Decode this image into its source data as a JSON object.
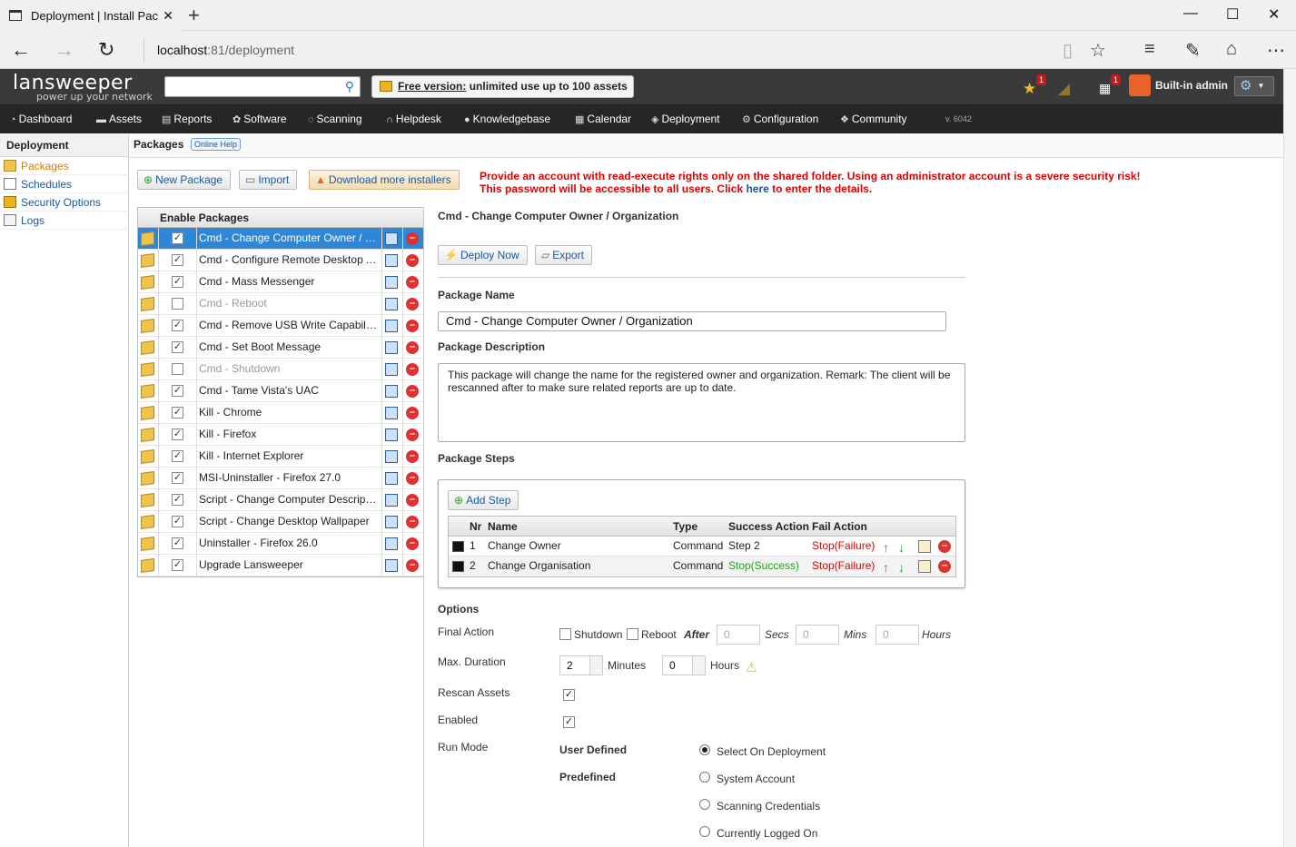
{
  "browser": {
    "tab_title": "Deployment | Install Pac",
    "url_host": "localhost",
    "url_rest": ":81/deployment"
  },
  "header": {
    "logo": "lansweeper",
    "tagline": "power up your network",
    "search_placeholder": "",
    "free_label": "Free version:",
    "free_text": " unlimited use up to 100 assets",
    "badge_star": "1",
    "badge_calendar": "1",
    "user": "Built-in admin"
  },
  "menu": {
    "items": [
      "Dashboard",
      "Assets",
      "Reports",
      "Software",
      "Scanning",
      "Helpdesk",
      "Knowledgebase",
      "Calendar",
      "Deployment",
      "Configuration",
      "Community"
    ],
    "version": "v. 6042"
  },
  "sidebar": {
    "title": "Deployment",
    "items": [
      "Packages",
      "Schedules",
      "Security Options",
      "Logs"
    ]
  },
  "crumb": {
    "title": "Packages",
    "help": "Online Help"
  },
  "toolbar": {
    "new_package": "New Package",
    "import": "Import",
    "download": "Download more installers"
  },
  "warning": {
    "line1": "Provide an account with read-execute rights only on the shared folder. Using an administrator account is a severe security risk!",
    "line2_pre": "This password will be accessible to all users. Click ",
    "line2_link": "here",
    "line2_post": " to enter the details."
  },
  "packages": {
    "header": "Enable Packages",
    "rows": [
      {
        "name": "Cmd - Change Computer Owner / Organization",
        "enabled": true
      },
      {
        "name": "Cmd - Configure Remote Desktop Access",
        "enabled": true
      },
      {
        "name": "Cmd - Mass Messenger",
        "enabled": true
      },
      {
        "name": "Cmd - Reboot",
        "enabled": false
      },
      {
        "name": "Cmd - Remove USB Write Capabilities",
        "enabled": true
      },
      {
        "name": "Cmd - Set Boot Message",
        "enabled": true
      },
      {
        "name": "Cmd - Shutdown",
        "enabled": false
      },
      {
        "name": "Cmd - Tame Vista's UAC",
        "enabled": true
      },
      {
        "name": "Kill - Chrome",
        "enabled": true
      },
      {
        "name": "Kill - Firefox",
        "enabled": true
      },
      {
        "name": "Kill - Internet Explorer",
        "enabled": true
      },
      {
        "name": "MSI-Uninstaller - Firefox 27.0",
        "enabled": true
      },
      {
        "name": "Script - Change Computer Description",
        "enabled": true
      },
      {
        "name": "Script - Change Desktop Wallpaper",
        "enabled": true
      },
      {
        "name": "Uninstaller - Firefox 26.0",
        "enabled": true
      },
      {
        "name": "Upgrade Lansweeper",
        "enabled": true
      }
    ]
  },
  "detail": {
    "title": "Cmd - Change Computer Owner / Organization",
    "deploy_now": "Deploy Now",
    "export": "Export",
    "package_name_label": "Package Name",
    "package_name": "Cmd - Change Computer Owner / Organization",
    "package_desc_label": "Package Description",
    "package_desc": "This package will change the name for the registered owner and organization. Remark: The client will be rescanned after to make sure related reports are up to date.",
    "package_steps_label": "Package Steps",
    "add_step": "Add Step",
    "steps_columns": [
      "Nr",
      "Name",
      "Type",
      "Success Action",
      "Fail Action"
    ],
    "steps": [
      {
        "nr": "1",
        "name": "Change Owner",
        "type": "Command",
        "success": "Step 2",
        "fail": "Stop(Failure)"
      },
      {
        "nr": "2",
        "name": "Change Organisation",
        "type": "Command",
        "success": "Stop(Success)",
        "fail": "Stop(Failure)"
      }
    ],
    "options_label": "Options",
    "final_action_label": "Final Action",
    "shutdown": "Shutdown",
    "reboot": "Reboot",
    "after": "After",
    "secs_value": "0",
    "secs": "Secs",
    "mins_value": "0",
    "mins": "Mins",
    "hours_value": "0",
    "hours": "Hours",
    "max_duration_label": "Max. Duration",
    "minutes_value": "2",
    "minutes": "Minutes",
    "dur_hours_value": "0",
    "dur_hours": "Hours",
    "rescan_label": "Rescan Assets",
    "enabled_label": "Enabled",
    "run_mode_label": "Run Mode",
    "user_defined": "User Defined",
    "predefined": "Predefined",
    "run_modes": [
      "Select On Deployment",
      "System Account",
      "Scanning Credentials",
      "Currently Logged On"
    ],
    "run_mode_selected": "Select On Deployment"
  }
}
